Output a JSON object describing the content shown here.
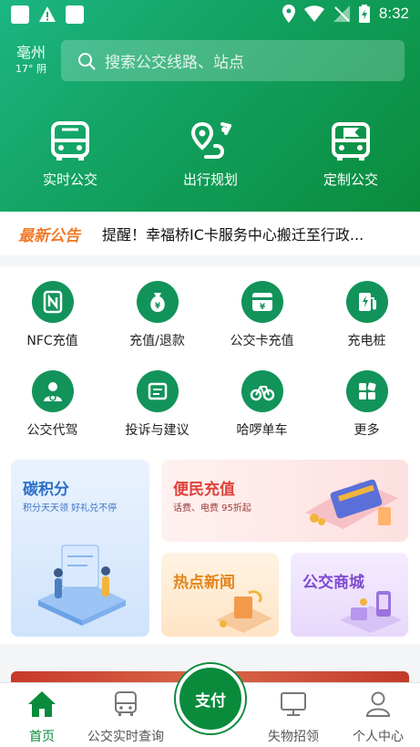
{
  "status_bar": {
    "time": "8:32"
  },
  "location": {
    "city": "亳州",
    "weather": "17° 阴"
  },
  "search": {
    "placeholder": "搜索公交线路、站点"
  },
  "quick_actions": [
    {
      "label": "实时公交",
      "icon": "bus-icon"
    },
    {
      "label": "出行规划",
      "icon": "route-plan-icon"
    },
    {
      "label": "定制公交",
      "icon": "custom-bus-icon"
    }
  ],
  "notice": {
    "tag": "最新公告",
    "text": "提醒！幸福桥IC卡服务中心搬迁至行政..."
  },
  "services": [
    {
      "label": "NFC充值",
      "icon": "nfc-icon"
    },
    {
      "label": "充值/退款",
      "icon": "money-bag-icon"
    },
    {
      "label": "公交卡充值",
      "icon": "bus-card-icon"
    },
    {
      "label": "充电桩",
      "icon": "charging-pile-icon"
    },
    {
      "label": "公交代驾",
      "icon": "driver-icon"
    },
    {
      "label": "投诉与建议",
      "icon": "complaint-icon"
    },
    {
      "label": "哈啰单车",
      "icon": "bike-icon"
    },
    {
      "label": "更多",
      "icon": "more-apps-icon"
    }
  ],
  "promo_cards": {
    "carbon": {
      "title": "碳积分",
      "subtitle": "积分天天领 好礼兑不停"
    },
    "recharge": {
      "title": "便民充值",
      "subtitle": "话费、电费 95折起"
    },
    "news": {
      "title": "热点新闻"
    },
    "mall": {
      "title": "公交商城"
    }
  },
  "pay_button": {
    "label": "支付"
  },
  "tabbar": [
    {
      "label": "首页",
      "icon": "home-icon",
      "active": true
    },
    {
      "label": "公交实时查询",
      "icon": "bus-query-icon",
      "active": false
    },
    {
      "label": "失物招领",
      "icon": "lost-found-icon",
      "active": false
    },
    {
      "label": "个人中心",
      "icon": "user-icon",
      "active": false
    }
  ],
  "colors": {
    "brand_green": "#0a8b3c",
    "notice_orange": "#f07a28",
    "carbon_blue": "#2b6fc9",
    "recharge_red": "#e0423a",
    "news_orange": "#e3851c",
    "mall_purple": "#7d4ad0"
  }
}
